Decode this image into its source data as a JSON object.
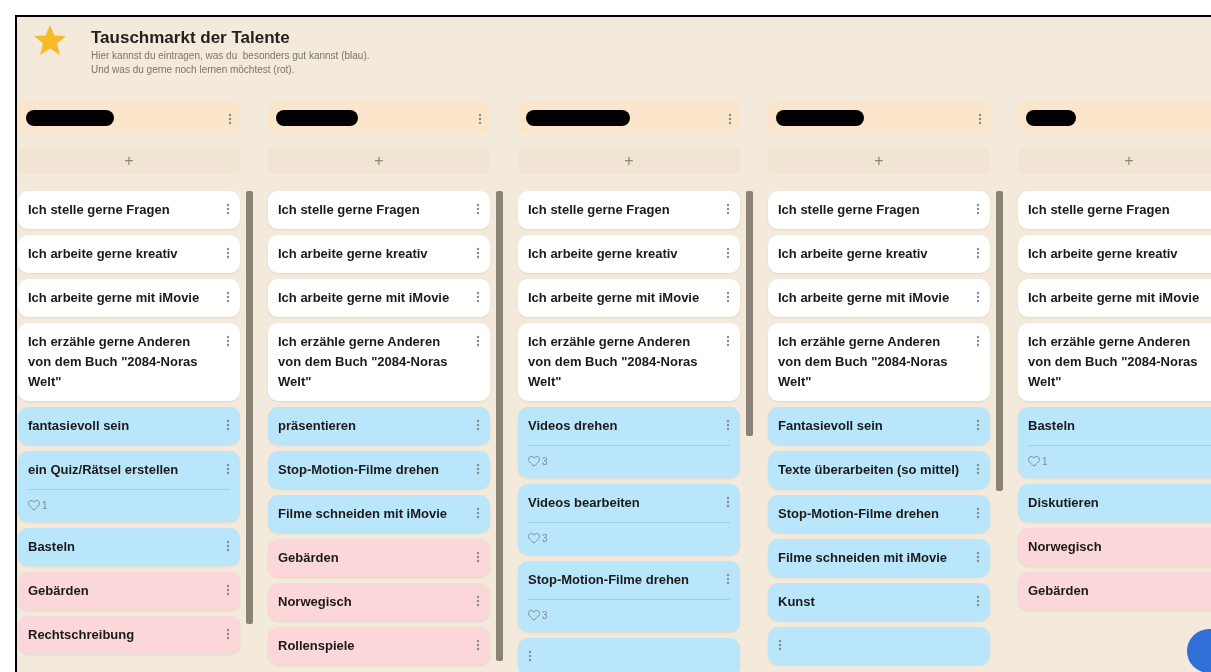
{
  "board": {
    "title": "Tauschmarkt der Talente",
    "description": [
      "Hier kannst du eintragen, was du  besonders gut kannst (blau).",
      "Und was du gerne noch lernen möchtest (rot)."
    ]
  },
  "add_label": "+",
  "columns": [
    {
      "cards": [
        {
          "text": "Ich stelle gerne Fragen",
          "color": "#ffffff"
        },
        {
          "text": "Ich arbeite gerne kreativ",
          "color": "#ffffff"
        },
        {
          "text": "Ich arbeite gerne mit iMovie",
          "color": "#ffffff"
        },
        {
          "text": "Ich erzähle gerne Anderen von dem Buch \"2084-Noras Welt\"",
          "color": "#ffffff"
        },
        {
          "text": "fantasievoll sein",
          "color": "#b9e6fb"
        },
        {
          "text": "ein Quiz/Rätsel erstellen",
          "color": "#b9e6fb",
          "likes": "1"
        },
        {
          "text": "Basteln",
          "color": "#b9e6fb"
        },
        {
          "text": "Gebärden",
          "color": "#fbd7da"
        },
        {
          "text": "Rechtschreibung",
          "color": "#fbd7da"
        }
      ]
    },
    {
      "cards": [
        {
          "text": "Ich stelle gerne Fragen",
          "color": "#ffffff"
        },
        {
          "text": "Ich arbeite gerne kreativ",
          "color": "#ffffff"
        },
        {
          "text": "Ich arbeite gerne mit iMovie",
          "color": "#ffffff"
        },
        {
          "text": "Ich erzähle gerne Anderen von dem Buch \"2084-Noras Welt\"",
          "color": "#ffffff"
        },
        {
          "text": "präsentieren",
          "color": "#b9e6fb"
        },
        {
          "text": "Stop-Motion-Filme drehen",
          "color": "#b9e6fb"
        },
        {
          "text": "Filme schneiden mit iMovie",
          "color": "#b9e6fb"
        },
        {
          "text": "Gebärden",
          "color": "#fbd7da"
        },
        {
          "text": "Norwegisch",
          "color": "#fbd7da"
        },
        {
          "text": "Rollenspiele",
          "color": "#fbd7da"
        }
      ]
    },
    {
      "cards": [
        {
          "text": "Ich stelle gerne Fragen",
          "color": "#ffffff"
        },
        {
          "text": "Ich arbeite gerne kreativ",
          "color": "#ffffff"
        },
        {
          "text": "Ich arbeite gerne mit iMovie",
          "color": "#ffffff"
        },
        {
          "text": "Ich erzähle gerne Anderen von dem Buch \"2084-Noras Welt\"",
          "color": "#ffffff"
        },
        {
          "text": "Videos drehen",
          "color": "#b9e6fb",
          "likes": "3"
        },
        {
          "text": "Videos bearbeiten",
          "color": "#b9e6fb",
          "likes": "3"
        },
        {
          "text": "Stop-Motion-Filme drehen",
          "color": "#b9e6fb",
          "likes": "3"
        },
        {
          "color": "#b9e6fb"
        }
      ]
    },
    {
      "cards": [
        {
          "text": "Ich stelle gerne Fragen",
          "color": "#ffffff"
        },
        {
          "text": "Ich arbeite gerne kreativ",
          "color": "#ffffff"
        },
        {
          "text": "Ich arbeite gerne mit iMovie",
          "color": "#ffffff"
        },
        {
          "text": "Ich erzähle gerne Anderen von dem Buch \"2084-Noras Welt\"",
          "color": "#ffffff"
        },
        {
          "text": "Fantasievoll sein",
          "color": "#b9e6fb"
        },
        {
          "text": "Texte überarbeiten (so mittel)",
          "color": "#b9e6fb"
        },
        {
          "text": "Stop-Motion-Filme drehen",
          "color": "#b9e6fb"
        },
        {
          "text": "Filme schneiden mit iMovie",
          "color": "#b9e6fb"
        },
        {
          "text": "Kunst",
          "color": "#b9e6fb"
        },
        {
          "color": "#b9e6fb"
        }
      ]
    },
    {
      "cards": [
        {
          "text": "Ich stelle gerne Fragen",
          "color": "#ffffff"
        },
        {
          "text": "Ich arbeite gerne kreativ",
          "color": "#ffffff"
        },
        {
          "text": "Ich arbeite gerne mit iMovie",
          "color": "#ffffff"
        },
        {
          "text": "Ich erzähle gerne Anderen von dem Buch \"2084-Noras Welt\"",
          "color": "#ffffff"
        },
        {
          "text": "Basteln",
          "color": "#b9e6fb",
          "likes": "1"
        },
        {
          "text": "Diskutieren",
          "color": "#b9e6fb"
        },
        {
          "text": "Norwegisch",
          "color": "#fbd7da"
        },
        {
          "text": "Gebärden",
          "color": "#fbd7da"
        }
      ]
    }
  ]
}
